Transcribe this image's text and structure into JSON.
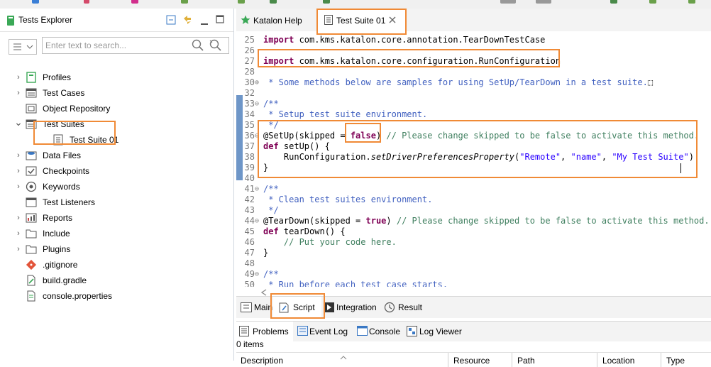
{
  "left_panel": {
    "title": "Tests Explorer",
    "search_placeholder": "Enter text to search...",
    "tree": [
      {
        "label": "Profiles",
        "icon": "profiles-icon",
        "expanded": false
      },
      {
        "label": "Test Cases",
        "icon": "test-cases-icon",
        "expanded": false
      },
      {
        "label": "Object Repository",
        "icon": "object-repository-icon",
        "expanded": false
      },
      {
        "label": "Test Suites",
        "icon": "test-suites-icon",
        "expanded": true
      },
      {
        "label": "Test Suite 01",
        "icon": "test-suite-icon",
        "expanded": false,
        "child": true,
        "selected": true
      },
      {
        "label": "Data Files",
        "icon": "data-files-icon",
        "expanded": false
      },
      {
        "label": "Checkpoints",
        "icon": "checkpoints-icon",
        "expanded": false
      },
      {
        "label": "Keywords",
        "icon": "keywords-icon",
        "expanded": false
      },
      {
        "label": "Test Listeners",
        "icon": "test-listeners-icon",
        "expanded": false
      },
      {
        "label": "Reports",
        "icon": "reports-icon",
        "expanded": false
      },
      {
        "label": "Include",
        "icon": "folder-icon",
        "expanded": false
      },
      {
        "label": "Plugins",
        "icon": "folder-icon",
        "expanded": false
      },
      {
        "label": ".gitignore",
        "icon": "git-icon",
        "expanded": false
      },
      {
        "label": "build.gradle",
        "icon": "gradle-file-icon",
        "expanded": false
      },
      {
        "label": "console.properties",
        "icon": "properties-file-icon",
        "expanded": false
      }
    ]
  },
  "editor": {
    "tabs": [
      {
        "label": "Katalon Help",
        "icon": "star-icon"
      },
      {
        "label": "Test Suite 01",
        "icon": "test-suite-icon",
        "active": true
      }
    ],
    "lines": [
      {
        "n": "25",
        "fold": "",
        "parts": [
          {
            "t": "import",
            "c": "kw"
          },
          {
            "t": " com.kms.katalon.core.annotation.TearDownTestCase",
            "c": ""
          }
        ]
      },
      {
        "n": "26",
        "fold": "",
        "parts": []
      },
      {
        "n": "27",
        "fold": "",
        "parts": [
          {
            "t": "import",
            "c": "kw"
          },
          {
            "t": " com.kms.katalon.core.configuration.RunConfiguration",
            "c": ""
          }
        ]
      },
      {
        "n": "28",
        "fold": "",
        "parts": []
      },
      {
        "n": "30",
        "fold": "⊕",
        "parts": [
          {
            "t": " * Some methods below are samples for using SetUp/TearDown in a test suite.",
            "c": "cm"
          },
          {
            "t": "⬚",
            "c": ""
          }
        ]
      },
      {
        "n": "32",
        "fold": "",
        "parts": []
      },
      {
        "n": "33",
        "fold": "⊖",
        "parts": [
          {
            "t": "/**",
            "c": "cm"
          }
        ]
      },
      {
        "n": "34",
        "fold": "",
        "parts": [
          {
            "t": " * Setup test suite environment.",
            "c": "cm"
          }
        ]
      },
      {
        "n": "35",
        "fold": "",
        "parts": [
          {
            "t": " */",
            "c": "cm"
          }
        ]
      },
      {
        "n": "36",
        "fold": "⊖",
        "parts": [
          {
            "t": "@SetUp(skipped = ",
            "c": ""
          },
          {
            "t": "false",
            "c": "kw"
          },
          {
            "t": ") ",
            "c": ""
          },
          {
            "t": "// Please change skipped to be false to activate this method.",
            "c": "cmg"
          }
        ]
      },
      {
        "n": "37",
        "fold": "",
        "parts": [
          {
            "t": "def",
            "c": "kw"
          },
          {
            "t": " setUp() {",
            "c": ""
          }
        ]
      },
      {
        "n": "38",
        "fold": "",
        "parts": [
          {
            "t": "    RunConfiguration.",
            "c": ""
          },
          {
            "t": "setDriverPreferencesProperty",
            "c": "it"
          },
          {
            "t": "(",
            "c": ""
          },
          {
            "t": "\"Remote\"",
            "c": "st"
          },
          {
            "t": ", ",
            "c": ""
          },
          {
            "t": "\"name\"",
            "c": "st"
          },
          {
            "t": ", ",
            "c": ""
          },
          {
            "t": "\"My Test Suite\"",
            "c": "st"
          },
          {
            "t": ")",
            "c": ""
          }
        ]
      },
      {
        "n": "39",
        "fold": "",
        "parts": [
          {
            "t": "}",
            "c": ""
          }
        ]
      },
      {
        "n": "40",
        "fold": "",
        "parts": []
      },
      {
        "n": "41",
        "fold": "⊖",
        "parts": [
          {
            "t": "/**",
            "c": "cm"
          }
        ]
      },
      {
        "n": "42",
        "fold": "",
        "parts": [
          {
            "t": " * Clean test suites environment.",
            "c": "cm"
          }
        ]
      },
      {
        "n": "43",
        "fold": "",
        "parts": [
          {
            "t": " */",
            "c": "cm"
          }
        ]
      },
      {
        "n": "44",
        "fold": "⊖",
        "parts": [
          {
            "t": "@TearDown(skipped = ",
            "c": ""
          },
          {
            "t": "true",
            "c": "kw"
          },
          {
            "t": ") ",
            "c": ""
          },
          {
            "t": "// Please change skipped to be false to activate this method.",
            "c": "cmg"
          }
        ]
      },
      {
        "n": "45",
        "fold": "",
        "parts": [
          {
            "t": "def",
            "c": "kw"
          },
          {
            "t": " tearDown() {",
            "c": ""
          }
        ]
      },
      {
        "n": "46",
        "fold": "",
        "parts": [
          {
            "t": "    // Put your code here.",
            "c": "cmg"
          }
        ]
      },
      {
        "n": "47",
        "fold": "",
        "parts": [
          {
            "t": "}",
            "c": ""
          }
        ]
      },
      {
        "n": "48",
        "fold": "",
        "parts": []
      },
      {
        "n": "49",
        "fold": "⊖",
        "parts": [
          {
            "t": "/**",
            "c": "cm"
          }
        ]
      },
      {
        "n": "50",
        "fold": "",
        "parts": [
          {
            "t": " * Run before each test case starts.",
            "c": "cm"
          }
        ]
      }
    ],
    "bottom_tabs": [
      {
        "label": "Main",
        "icon": "main-icon"
      },
      {
        "label": "Script",
        "icon": "script-icon",
        "active": true
      },
      {
        "label": "Integration",
        "icon": "integration-icon"
      },
      {
        "label": "Result",
        "icon": "result-icon"
      }
    ]
  },
  "console": {
    "tabs": [
      {
        "label": "Problems",
        "icon": "problems-icon",
        "active": true
      },
      {
        "label": "Event Log",
        "icon": "event-log-icon"
      },
      {
        "label": "Console",
        "icon": "console-icon"
      },
      {
        "label": "Log Viewer",
        "icon": "log-viewer-icon"
      }
    ],
    "items_count": "0 items",
    "columns": [
      "Description",
      "Resource",
      "Path",
      "Location",
      "Type"
    ]
  },
  "colors": {
    "highlight": "#f08a36",
    "keyword": "#7f0055",
    "javadoc": "#3f5fbf",
    "comment": "#3f7f5f",
    "string": "#2a00ff"
  }
}
